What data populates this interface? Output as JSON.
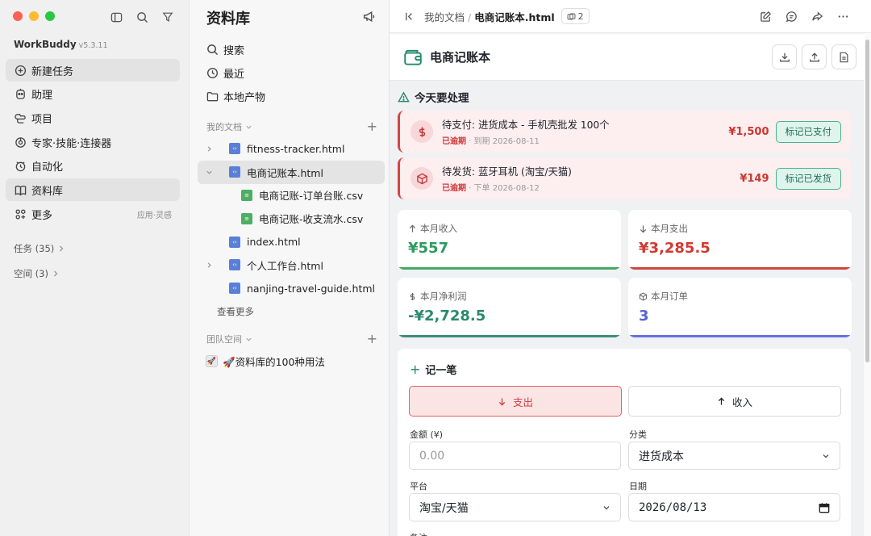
{
  "sidebar": {
    "app_name": "WorkBuddy",
    "version": "v5.3.11",
    "items": [
      {
        "label": "新建任务",
        "icon": "new-task-icon"
      },
      {
        "label": "助理",
        "icon": "assistant-icon"
      },
      {
        "label": "项目",
        "icon": "project-icon"
      },
      {
        "label": "专家·技能·连接器",
        "icon": "expert-icon"
      },
      {
        "label": "自动化",
        "icon": "automation-icon"
      },
      {
        "label": "资料库",
        "icon": "library-icon"
      },
      {
        "label": "更多",
        "icon": "more-grid-icon",
        "extra": "应用·灵感"
      }
    ],
    "groups": [
      {
        "label": "任务 (35)"
      },
      {
        "label": "空间 (3)"
      }
    ]
  },
  "library": {
    "title": "资料库",
    "nav": [
      {
        "label": "搜索"
      },
      {
        "label": "最近"
      },
      {
        "label": "本地产物"
      }
    ],
    "my_docs_label": "我的文档",
    "files": [
      {
        "name": "fitness-tracker.html",
        "type": "html"
      },
      {
        "name": "电商记账本.html",
        "type": "html"
      },
      {
        "name": "电商记账-订单台账.csv",
        "type": "csv"
      },
      {
        "name": "电商记账-收支流水.csv",
        "type": "csv"
      },
      {
        "name": "index.html",
        "type": "html"
      },
      {
        "name": "个人工作台.html",
        "type": "html"
      },
      {
        "name": "nanjing-travel-guide.html",
        "type": "html"
      }
    ],
    "see_more": "查看更多",
    "team_space_label": "团队空间",
    "team_item": "🚀资料库的100种用法"
  },
  "topbar": {
    "crumb_parent": "我的文档",
    "crumb_sep": "/",
    "crumb_current": "电商记账本.html",
    "badge_count": "2"
  },
  "app": {
    "title": "电商记账本",
    "section_title": "今天要处理",
    "todos": [
      {
        "title": "待支付: 进货成本 - 手机壳批发 100个",
        "status": "已逾期",
        "meta": "· 到期 2026-08-11",
        "amount": "¥1,500",
        "action": "标记已支付",
        "symbol": "$"
      },
      {
        "title": "待发货: 蓝牙耳机 (淘宝/天猫)",
        "status": "已逾期",
        "meta": "· 下单 2026-08-12",
        "amount": "¥149",
        "action": "标记已发货",
        "symbol": "box"
      }
    ],
    "stats": [
      {
        "label": "本月收入",
        "value": "¥557",
        "color": "#2e9a5e",
        "bar": "#45a865"
      },
      {
        "label": "本月支出",
        "value": "¥3,285.5",
        "color": "#cf3a31",
        "bar": "#d0473b"
      },
      {
        "label": "本月净利润",
        "value": "-¥2,728.5",
        "color": "#2a8a6e",
        "bar": "#3a8f76"
      },
      {
        "label": "本月订单",
        "value": "3",
        "color": "#5561d8",
        "bar": "#6a6fe0"
      }
    ],
    "form": {
      "title": "记一笔",
      "expense_label": "支出",
      "income_label": "收入",
      "amount_label": "金额 (¥)",
      "amount_placeholder": "0.00",
      "category_label": "分类",
      "category_value": "进货成本",
      "platform_label": "平台",
      "platform_value": "淘宝/天猫",
      "date_label": "日期",
      "date_value": "2026/08/13",
      "note_label": "备注"
    }
  }
}
